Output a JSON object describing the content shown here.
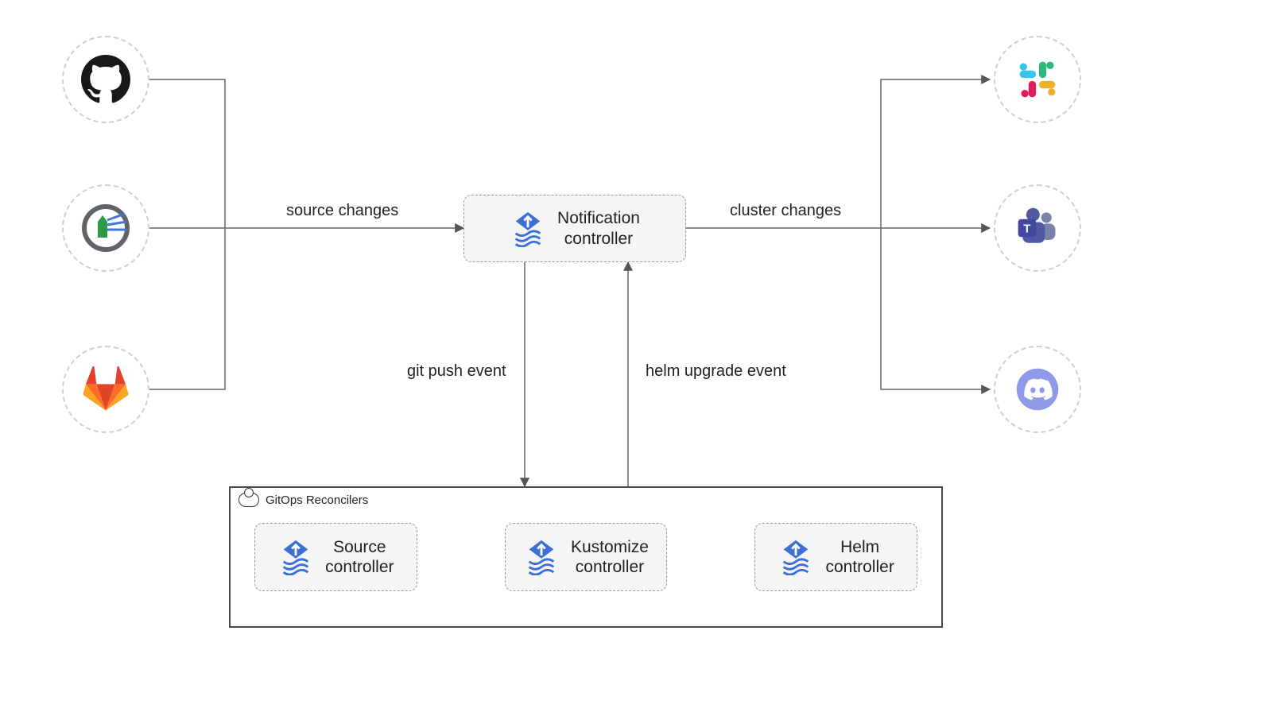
{
  "edges": {
    "source_changes": "source changes",
    "cluster_changes": "cluster changes",
    "git_push_event": "git push event",
    "helm_upgrade_event": "helm upgrade event"
  },
  "nodes": {
    "notification_controller": "Notification\ncontroller",
    "source_controller": "Source\ncontroller",
    "kustomize_controller": "Kustomize\ncontroller",
    "helm_controller": "Helm\ncontroller"
  },
  "container": {
    "title": "GitOps Reconcilers"
  },
  "left_sources": [
    "github",
    "harbor",
    "gitlab"
  ],
  "right_targets": [
    "slack",
    "teams",
    "discord"
  ]
}
